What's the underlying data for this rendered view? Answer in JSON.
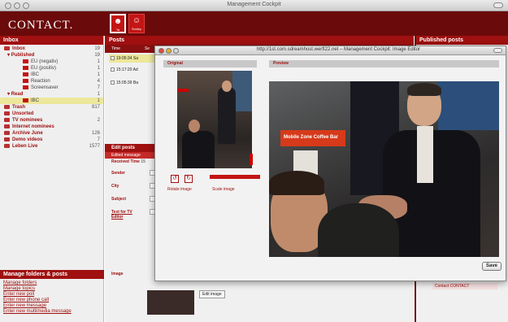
{
  "window": {
    "title": "Management Cockpit"
  },
  "app": {
    "logo": "CONTACT.",
    "buttons": [
      {
        "label": "Ta"
      },
      {
        "label": "Smiley"
      }
    ]
  },
  "sidebar": {
    "header": "Inbox",
    "items": [
      {
        "label": "Inbox",
        "count": "19"
      },
      {
        "label": "Published",
        "count": "19"
      },
      {
        "label": "EU (negativ)",
        "count": "1"
      },
      {
        "label": "EU (positiv)",
        "count": "1"
      },
      {
        "label": "IBC",
        "count": "1"
      },
      {
        "label": "Reaction",
        "count": "4"
      },
      {
        "label": "Screensaver",
        "count": "7"
      },
      {
        "label": "Read",
        "count": "1"
      },
      {
        "label": "IBC",
        "count": "1"
      },
      {
        "label": "Trash",
        "count": "817"
      },
      {
        "label": "Unsorted",
        "count": ""
      },
      {
        "label": "TV nominees",
        "count": "2"
      },
      {
        "label": "Internet nominees",
        "count": ""
      },
      {
        "label": "Archive June",
        "count": "126"
      },
      {
        "label": "Demo videos",
        "count": "7"
      },
      {
        "label": "Leben Live",
        "count": "1577"
      }
    ],
    "manage": {
      "header": "Manage folders & posts",
      "links": [
        "Manage folders",
        "Manage topics",
        "Enter new poll",
        "Enter new phone call",
        "Enter new message",
        "Enter new multimedia message"
      ]
    }
  },
  "posts": {
    "header": "Posts",
    "col_time": "Time",
    "col_sender": "Se",
    "rows": [
      {
        "time": "19:05:34",
        "extra": "Sa"
      },
      {
        "time": "15:17:20",
        "extra": "Ad"
      },
      {
        "time": "15:05:39",
        "extra": "Ba"
      }
    ],
    "edit": {
      "header": "Edit posts",
      "subheader": "Edited message",
      "fields": [
        "Received Time",
        "Sender",
        "City",
        "Subject",
        "Text for TV Editor",
        "Image"
      ],
      "received_value": "15",
      "edit_image_button": "Edit image"
    }
  },
  "published": {
    "header": "Published posts",
    "item": "Contact CONTACT"
  },
  "dialog": {
    "title": "http://1st.com.sdreamhost.werft22.net – Management Cockpit: Image Editor",
    "original_label": "Original",
    "preview_label": "Preview",
    "rotate_label": "Rotate image",
    "scale_label": "Scale image",
    "save_label": "Save",
    "preview_banner": "Mobile Zone Coffee Bar",
    "scale_level": 0.85
  },
  "colors": {
    "accent": "#a01010",
    "dark": "#6b0a0a",
    "highlight": "#ece79a"
  }
}
